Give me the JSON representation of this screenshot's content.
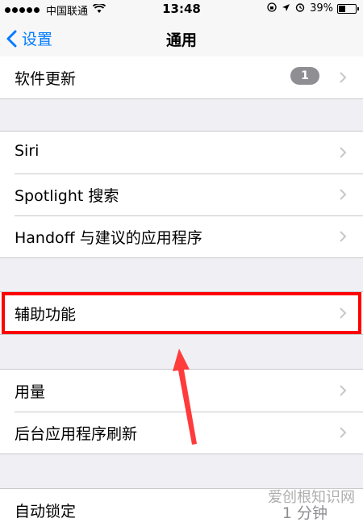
{
  "status_bar": {
    "carrier": "中国联通",
    "time": "13:48",
    "battery": "39%",
    "battery_level": 0.39
  },
  "nav": {
    "back_label": "设置",
    "title": "通用"
  },
  "groups": [
    {
      "rows": [
        {
          "label": "软件更新",
          "badge": "1"
        }
      ]
    },
    {
      "rows": [
        {
          "label": "Siri"
        },
        {
          "label": "Spotlight 搜索"
        },
        {
          "label": "Handoff 与建议的应用程序"
        }
      ]
    },
    {
      "rows": [
        {
          "label": "辅助功能"
        }
      ]
    },
    {
      "rows": [
        {
          "label": "用量"
        },
        {
          "label": "后台应用程序刷新"
        }
      ]
    },
    {
      "rows": [
        {
          "label": "自动锁定",
          "value": "1 分钟"
        }
      ]
    }
  ],
  "annotation": {
    "highlight_color": "#ff0000",
    "arrow_color": "#ff3b3b"
  },
  "watermark": "爱创根知识网",
  "colors": {
    "accent": "#007aff",
    "background": "#efeff4",
    "badge": "#8e8e93"
  }
}
